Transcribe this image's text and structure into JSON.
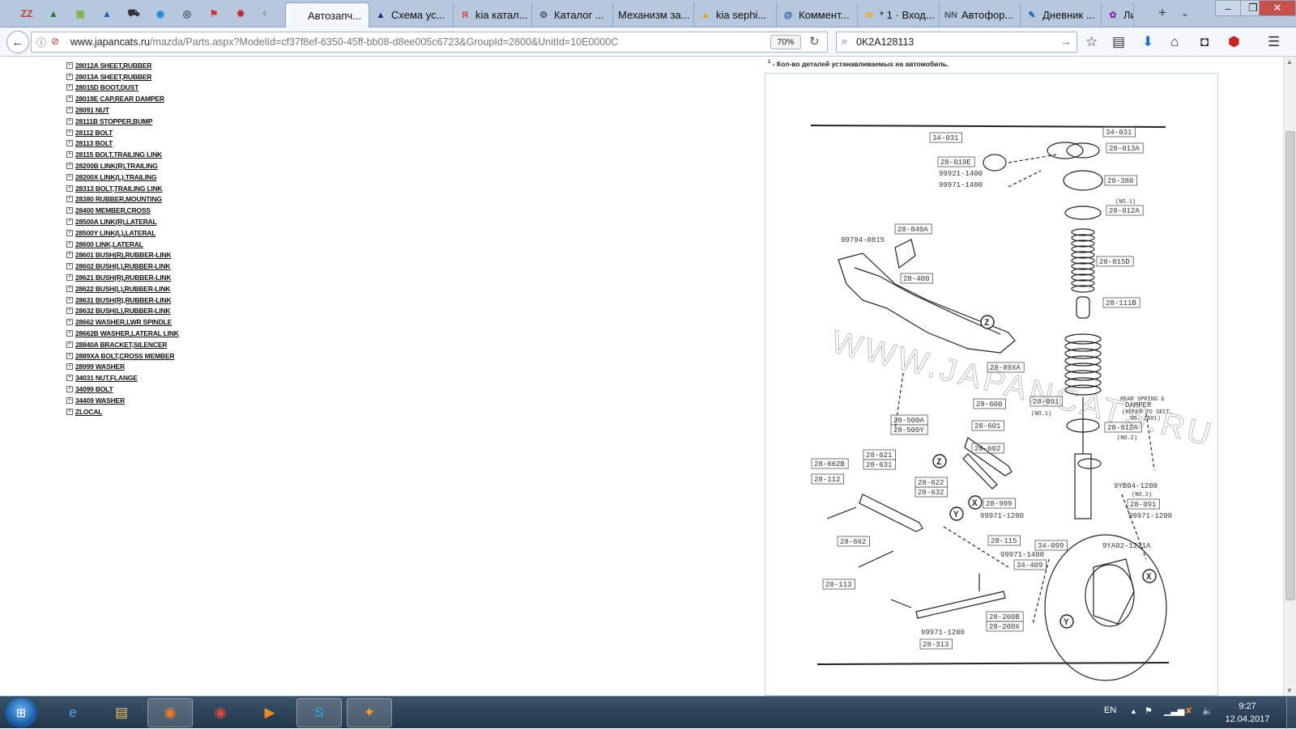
{
  "browser": {
    "pinned_tabs": [
      {
        "icon": "zz-icon",
        "glyph": "ZZ",
        "color": "#c0392b"
      },
      {
        "icon": "image-icon",
        "glyph": "▲",
        "color": "#2e7d32"
      },
      {
        "icon": "android-icon",
        "glyph": "▣",
        "color": "#7cb342"
      },
      {
        "icon": "signal-icon",
        "glyph": "▲",
        "color": "#1565c0"
      },
      {
        "icon": "cart-icon",
        "glyph": "⛟",
        "color": "#333333"
      },
      {
        "icon": "globe-icon",
        "glyph": "◉",
        "color": "#1e88e5"
      },
      {
        "icon": "wheel-icon",
        "glyph": "◎",
        "color": "#555555"
      },
      {
        "icon": "flag-icon",
        "glyph": "⚑",
        "color": "#d32f2f"
      },
      {
        "icon": "gear-red-icon",
        "glyph": "✹",
        "color": "#c62828"
      }
    ],
    "tabs": [
      {
        "label": "Автозапч...",
        "icon": "page-icon",
        "glyph": "",
        "color": "#999999",
        "active": true
      },
      {
        "label": "Схема ус...",
        "icon": "triangle-icon",
        "glyph": "▲",
        "color": "#1a237e",
        "active": false
      },
      {
        "label": "kia катал...",
        "icon": "yandex-icon",
        "glyph": "Я",
        "color": "#e53935",
        "active": false
      },
      {
        "label": "Каталог ...",
        "icon": "gear-icon",
        "glyph": "⚙",
        "color": "#555555",
        "active": false
      },
      {
        "label": "Механизм за...",
        "icon": "",
        "glyph": "",
        "color": "#999999",
        "active": false
      },
      {
        "label": "kia sephi...",
        "icon": "car-icon",
        "glyph": "▲",
        "color": "#e6a100",
        "active": false
      },
      {
        "label": "Коммент...",
        "icon": "at-icon",
        "glyph": "@",
        "color": "#0d47a1",
        "active": false
      },
      {
        "label": "* 1 · Вход...",
        "icon": "mail-icon",
        "glyph": "✉",
        "color": "#f9a825",
        "active": false
      },
      {
        "label": "Автофор...",
        "icon": "nn-icon",
        "glyph": "NN",
        "color": "#455a64",
        "active": false
      },
      {
        "label": "Дневник ...",
        "icon": "pen-icon",
        "glyph": "✎",
        "color": "#1565c0",
        "active": false
      },
      {
        "label": "Ли",
        "icon": "puzzle-icon",
        "glyph": "✿",
        "color": "#8e24aa",
        "active": false
      }
    ],
    "url": {
      "host": "www.japancats.ru",
      "path": "/mazda/Parts.aspx?ModelId=cf37f8ef-6350-45ff-bb08-d8ee005c6723&GroupId=2800&UnitId=10E0000C"
    },
    "zoom": "70%",
    "search_value": "0K2A128113"
  },
  "page": {
    "footnote_marker": "1",
    "footnote": " - Кол-во деталей устанавливаемых на автомобиль.",
    "parts": [
      {
        "code": "28012A",
        "name": "SHEET,RUBBER"
      },
      {
        "code": "28013A",
        "name": "SHEET,RUBBER"
      },
      {
        "code": "28015D",
        "name": "BOOT,DUST"
      },
      {
        "code": "28019E",
        "name": "CAP,REAR DAMPER"
      },
      {
        "code": "28091",
        "name": "NUT"
      },
      {
        "code": "28111B",
        "name": "STOPPER,BUMP"
      },
      {
        "code": "28112",
        "name": "BOLT"
      },
      {
        "code": "28113",
        "name": "BOLT"
      },
      {
        "code": "28115",
        "name": "BOLT,TRAILING LINK"
      },
      {
        "code": "28200B",
        "name": "LINK(R),TRAILING"
      },
      {
        "code": "28200X",
        "name": "LINK(L),TRAILING"
      },
      {
        "code": "28313",
        "name": "BOLT,TRAILING LINK"
      },
      {
        "code": "28380",
        "name": "RUBBER,MOUNTING"
      },
      {
        "code": "28400",
        "name": "MEMBER,CROSS"
      },
      {
        "code": "28500A",
        "name": "LINK(R),LATERAL"
      },
      {
        "code": "28500Y",
        "name": "LINK(L),LATERAL"
      },
      {
        "code": "28600",
        "name": "LINK,LATERAL"
      },
      {
        "code": "28601",
        "name": "BUSH(R),RUBBER-LINK"
      },
      {
        "code": "28602",
        "name": "BUSH(L),RUBBER-LINK"
      },
      {
        "code": "28621",
        "name": "BUSH(R),RUBBER-LINK"
      },
      {
        "code": "28622",
        "name": "BUSH(L),RUBBER-LINK"
      },
      {
        "code": "28631",
        "name": "BUSH(R),RUBBER-LINK"
      },
      {
        "code": "28632",
        "name": "BUSH(L),RUBBER-LINK"
      },
      {
        "code": "28662",
        "name": "WASHER,LWR SPINDLE"
      },
      {
        "code": "28662B",
        "name": "WASHER,LATERAL LINK"
      },
      {
        "code": "28840A",
        "name": "BRACKET,SILENCER"
      },
      {
        "code": "2889XA",
        "name": "BOLT,CROSS MEMBER"
      },
      {
        "code": "28999",
        "name": "WASHER"
      },
      {
        "code": "34031",
        "name": "NUT,FLANGE"
      },
      {
        "code": "34099",
        "name": "BOLT"
      },
      {
        "code": "34409",
        "name": "WASHER"
      },
      {
        "code": "ZLOCAL",
        "name": ""
      }
    ],
    "diagram": {
      "watermark": "WWW.JAPANCATS.RU",
      "callouts": [
        "34-031",
        "28-019E",
        "99921-1400",
        "99971-1400",
        "34-031",
        "28-013A",
        "28-380",
        "(NO.1)",
        "28-012A",
        "28-840A",
        "99794-0815",
        "28-015D",
        "28-400",
        "28-111B",
        "28-89XA",
        "REAR SPRING &",
        "DAMPER",
        "(REFER TO SECT.",
        "NO. 2801)",
        "28-600",
        "28-091",
        "(NO.1)",
        "28-500A",
        "28-500Y",
        "28-601",
        "28-012A",
        "(NO.2)",
        "28-602",
        "28-662B",
        "28-621",
        "28-631",
        "28-112",
        "28-622",
        "28-632",
        "9YB04-1208",
        "(NO.2)",
        "28-091",
        "28-999",
        "99971-1200",
        "99971-1200",
        "28-662",
        "28-115",
        "34-099",
        "9YA02-1231A",
        "99971-1400",
        "34-409",
        "28-113",
        "28-200B",
        "28-200X",
        "99971-1200",
        "28-313",
        "Z",
        "Z",
        "X",
        "X",
        "Y",
        "Y"
      ]
    }
  },
  "taskbar": {
    "apps": [
      {
        "icon": "ie-icon",
        "glyph": "e",
        "color": "#4fa3e8",
        "active": false
      },
      {
        "icon": "explorer-icon",
        "glyph": "▤",
        "color": "#f0c65a",
        "active": false
      },
      {
        "icon": "firefox-icon",
        "glyph": "◉",
        "color": "#ff7a1a",
        "active": true
      },
      {
        "icon": "chrome-icon",
        "glyph": "◉",
        "color": "#e5483b",
        "active": false
      },
      {
        "icon": "media-player-icon",
        "glyph": "▶",
        "color": "#f08a24",
        "active": false
      },
      {
        "icon": "skype-icon",
        "glyph": "S",
        "color": "#22a7e8",
        "active": true
      },
      {
        "icon": "game-icon",
        "glyph": "✦",
        "color": "#f2a01e",
        "active": true
      }
    ],
    "language": "EN",
    "time": "9:27",
    "date": "12.04.2017"
  }
}
